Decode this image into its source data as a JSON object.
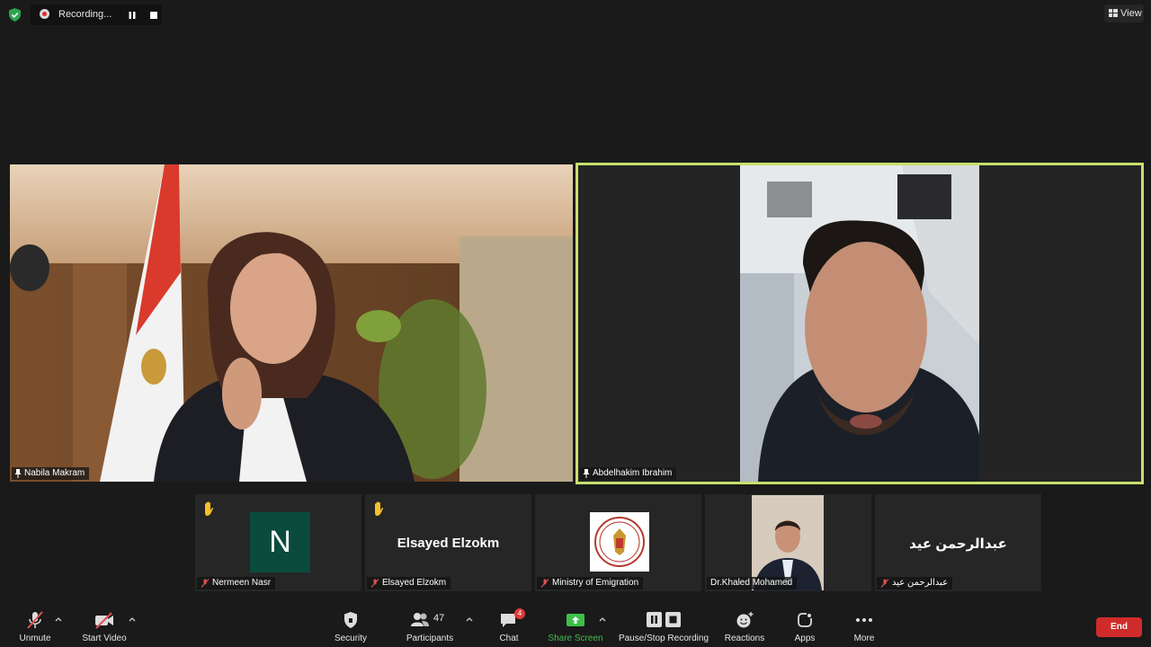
{
  "recording": {
    "label": "Recording..."
  },
  "view": {
    "label": "View"
  },
  "main_tiles": [
    {
      "name": "Nabila Makram"
    },
    {
      "name": "Abdelhakim Ibrahim",
      "active_speaker": true
    }
  ],
  "gallery": [
    {
      "name": "Nermeen Nasr",
      "avatar_letter": "N",
      "hand_raised": true,
      "muted": true
    },
    {
      "name": "Elsayed Elzokm",
      "display_name": "Elsayed Elzokm",
      "hand_raised": true,
      "muted": true
    },
    {
      "name": "Ministry of Emigration",
      "muted": true
    },
    {
      "name": "Dr.Khaled Mohamed",
      "muted": false
    },
    {
      "name": "عبدالرحمن عيد",
      "display_name": "عبدالرحمن عيد",
      "muted": true
    }
  ],
  "toolbar": {
    "unmute": "Unmute",
    "start_video": "Start Video",
    "security": "Security",
    "participants": "Participants",
    "participants_count": "47",
    "chat": "Chat",
    "chat_badge": "4",
    "share_screen": "Share Screen",
    "pause_stop_recording": "Pause/Stop Recording",
    "reactions": "Reactions",
    "apps": "Apps",
    "more": "More",
    "end": "End"
  },
  "colors": {
    "background": "#1a1a1a",
    "active_speaker_border": "#c7e06b",
    "share_green": "#3fbf4a",
    "end_red": "#d02b2b",
    "badge_red": "#e03a3a",
    "muted_red": "#e05050"
  }
}
